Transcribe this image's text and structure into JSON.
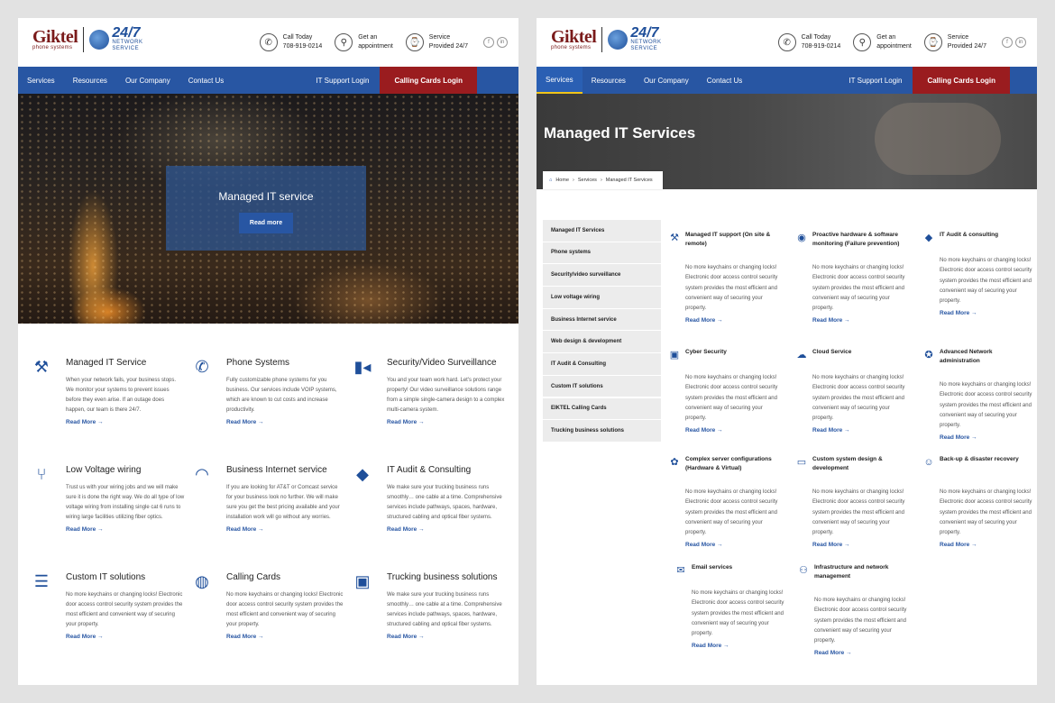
{
  "header": {
    "logo_text": "Giktel",
    "logo_sub": "phone systems",
    "ns_big": "24/7",
    "ns_small": "NETWORK SERVICE",
    "contacts": [
      {
        "icon": "phone-icon",
        "glyph": "✆",
        "line1": "Call Today",
        "line2": "708-919-0214"
      },
      {
        "icon": "location-pin-icon",
        "glyph": "⚲",
        "line1": "Get an",
        "line2": "appointment"
      },
      {
        "icon": "clock-icon",
        "glyph": "⌚",
        "line1": "Service",
        "line2": "Provided 24/7"
      }
    ],
    "social": [
      {
        "icon": "facebook-icon",
        "glyph": "f"
      },
      {
        "icon": "linkedin-icon",
        "glyph": "in"
      }
    ]
  },
  "nav": {
    "items": [
      "Services",
      "Resources",
      "Our Company",
      "Contact Us"
    ],
    "it_login": "IT Support Login",
    "cc_login": "Calling Cards Login"
  },
  "left": {
    "hero_title": "Managed IT service",
    "hero_button": "Read more",
    "services": [
      {
        "icon": "tools-icon",
        "glyph": "⚒",
        "title": "Managed IT Service",
        "desc": "When your network fails, your business stops. We monitor your systems to prevent issues before they even arise. If an outage does happen, our team is there 24/7.",
        "more": "Read More  →"
      },
      {
        "icon": "phone-icon",
        "glyph": "✆",
        "title": "Phone Systems",
        "desc": "Fully customizable phone systems for you business. Our services include VOIP systems, which are known to cut costs and increase productivity.",
        "more": "Read More  →"
      },
      {
        "icon": "camera-icon",
        "glyph": "▮◂",
        "title": "Security/Video Surveillance",
        "desc": "You and your team work hard. Let's protect your property! Our video surveillance solutions range from a simple single-camera design to a complex multi-camera system.",
        "more": "Read More  →"
      },
      {
        "icon": "cable-icon",
        "glyph": "⑂",
        "title": "Low Voltage wiring",
        "desc": "Trust us with your wiring jobs and we will make sure it is done the right way. We do all type of low voltage wiring from installing single cat 6 runs to wiring large facilities utilizing fiber optics.",
        "more": "Read More  →"
      },
      {
        "icon": "wifi-icon",
        "glyph": "◠",
        "title": "Business Internet service",
        "desc": "If you are looking for AT&T or Comcast service for your business look no further. We will make sure you get the best pricing available and your installation work will go without any worries.",
        "more": "Read More  →"
      },
      {
        "icon": "graduation-cap-icon",
        "glyph": "◆",
        "title": "IT Audit & Consulting",
        "desc": "We make sure your trucking business runs smoothly… one cable at a time. Comprehensive services include pathways, spaces, hardware, structured cabling and optical fiber systems.",
        "more": "Read More  →"
      },
      {
        "icon": "clipboard-icon",
        "glyph": "☰",
        "title": "Custom IT solutions",
        "desc": "No more keychains or changing locks! Electronic door access control security system provides the most efficient and convenient way of securing your property.",
        "more": "Read More  →"
      },
      {
        "icon": "globe-icon",
        "glyph": "◍",
        "title": "Calling Cards",
        "desc": "No more keychains or changing locks! Electronic door access control security system provides the most efficient and convenient way of securing your property.",
        "more": "Read More  →"
      },
      {
        "icon": "bus-icon",
        "glyph": "▣",
        "title": "Trucking business solutions",
        "desc": "We make sure your trucking business runs smoothly… one cable at a time. Comprehensive services include pathways, spaces, hardware, structured cabling and optical fiber systems.",
        "more": "Read More  →"
      }
    ]
  },
  "right": {
    "title": "Managed IT Services",
    "breadcrumb": [
      "Home",
      "Services",
      "Managed IT Services"
    ],
    "sidebar": [
      "Managed IT Services",
      "Phone systems",
      "Security/video surveillance",
      "Low voltage wiring",
      "Business Internet service",
      "Web design & development",
      "IT Audit & Consulting",
      "Custom IT solutions",
      "EIKTEL Calling Cards",
      "Trucking business solutions"
    ],
    "desc": "No more keychains or changing locks! Electronic door access control security system provides the most efficient and convenient way of securing your property.",
    "more": "Read More  →",
    "services": [
      {
        "icon": "tools-icon",
        "glyph": "⚒",
        "title": "Managed IT support (On site & remote)"
      },
      {
        "icon": "eye-icon",
        "glyph": "◉",
        "title": "Proactive hardware & software monitoring (Failure prevention)"
      },
      {
        "icon": "graduation-cap-icon",
        "glyph": "◆",
        "title": "IT Audit & consulting"
      },
      {
        "icon": "lock-icon",
        "glyph": "▣",
        "title": "Cyber Security"
      },
      {
        "icon": "cloud-icon",
        "glyph": "☁",
        "title": "Cloud Service"
      },
      {
        "icon": "award-icon",
        "glyph": "✪",
        "title": "Advanced Network administration"
      },
      {
        "icon": "medal-icon",
        "glyph": "✿",
        "title": "Complex server configurations (Hardware & Virtual)"
      },
      {
        "icon": "monitor-icon",
        "glyph": "▭",
        "title": "Custom system design & development"
      },
      {
        "icon": "smile-icon",
        "glyph": "☺",
        "title": "Back-up & disaster recovery"
      },
      {
        "icon": "email-icon",
        "glyph": "✉",
        "title": "Email services"
      },
      {
        "icon": "users-icon",
        "glyph": "⚇",
        "title": "Infrastructure and network management"
      }
    ]
  }
}
